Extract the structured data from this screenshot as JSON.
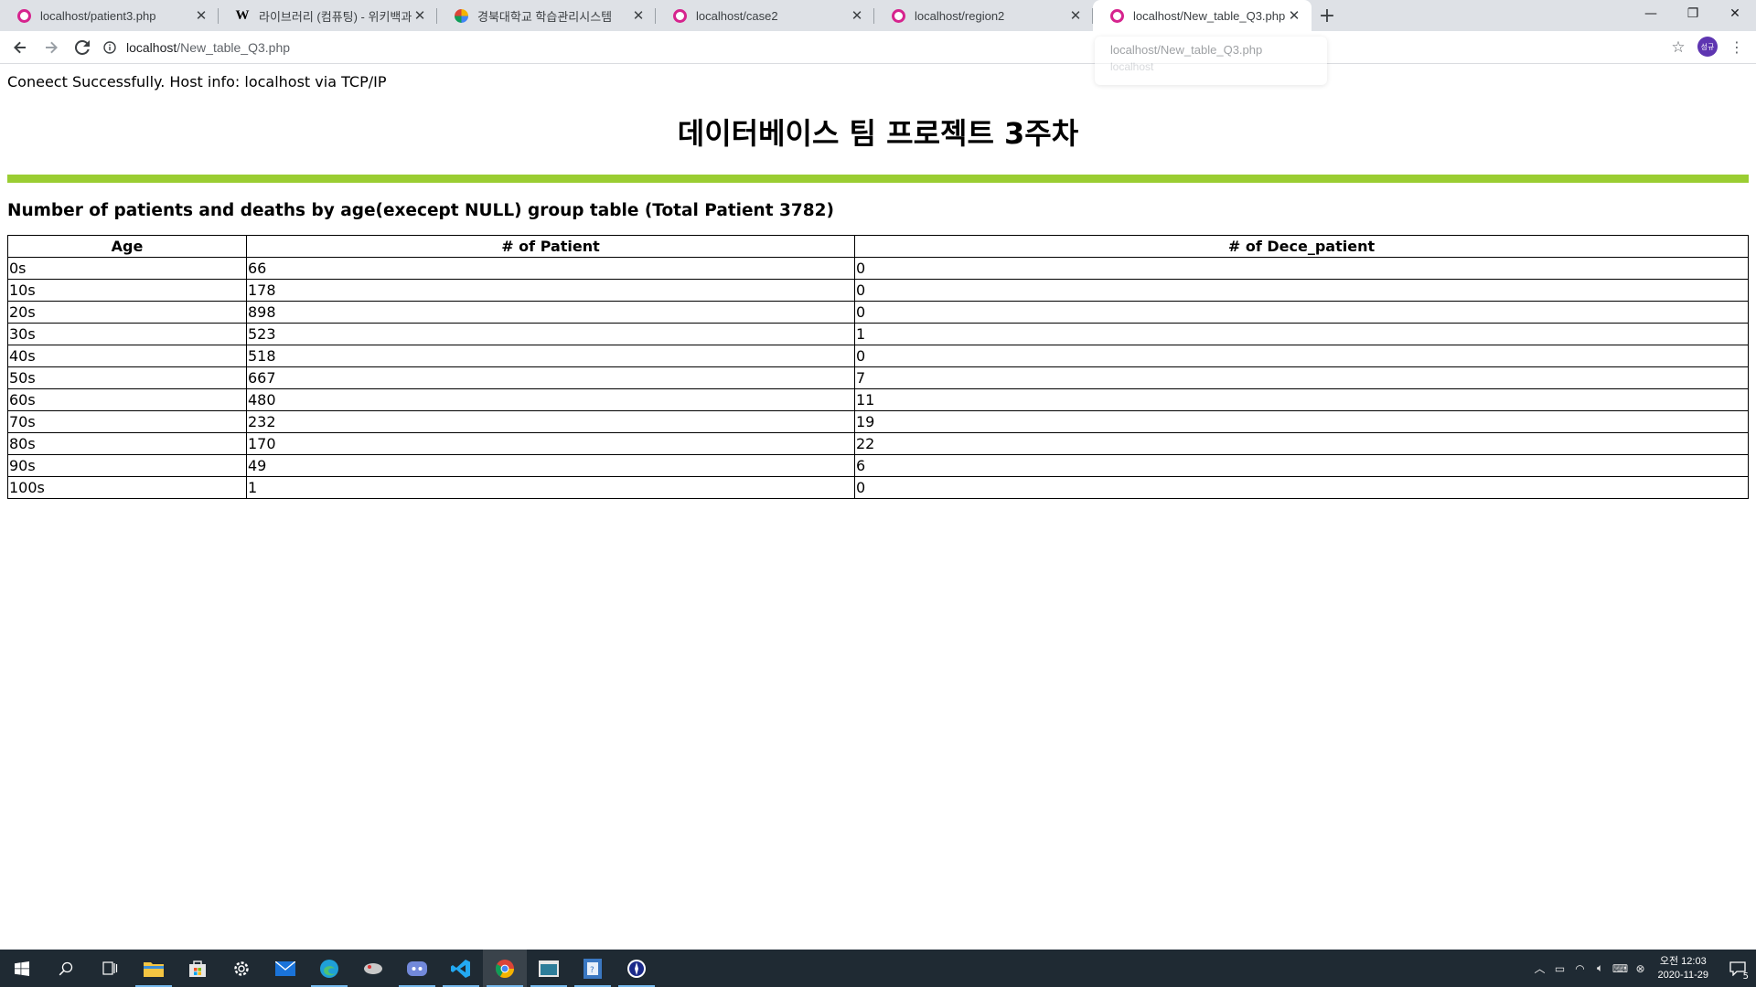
{
  "browser": {
    "tabs": [
      {
        "title": "localhost/patient3.php",
        "favicon": "localhost-icon"
      },
      {
        "title": "라이브러리 (컴퓨팅) - 위키백과",
        "favicon": "wikipedia-icon"
      },
      {
        "title": "경북대학교 학습관리시스템",
        "favicon": "knu-lms-icon"
      },
      {
        "title": "localhost/case2",
        "favicon": "localhost-icon"
      },
      {
        "title": "localhost/region2",
        "favicon": "localhost-icon"
      },
      {
        "title": "localhost/New_table_Q3.php",
        "favicon": "localhost-icon",
        "active": true
      }
    ],
    "url_host": "localhost",
    "url_path": "/New_table_Q3.php",
    "hover_card": {
      "title": "localhost/New_table_Q3.php",
      "domain": "localhost"
    },
    "profile_initials": "성규"
  },
  "page": {
    "status": "Coneect Successfully. Host info: localhost via TCP/IP",
    "title": "데이터베이스 팀 프로젝트 3주차",
    "rule_color": "#9acd32",
    "subtitle": "Number of patients and deaths by age(execept NULL) group table (Total Patient 3782)",
    "table": {
      "headers": [
        "Age",
        "# of Patient",
        "# of Dece_patient"
      ],
      "rows": [
        [
          "0s",
          "66",
          "0"
        ],
        [
          "10s",
          "178",
          "0"
        ],
        [
          "20s",
          "898",
          "0"
        ],
        [
          "30s",
          "523",
          "1"
        ],
        [
          "40s",
          "518",
          "0"
        ],
        [
          "50s",
          "667",
          "7"
        ],
        [
          "60s",
          "480",
          "11"
        ],
        [
          "70s",
          "232",
          "19"
        ],
        [
          "80s",
          "170",
          "22"
        ],
        [
          "90s",
          "49",
          "6"
        ],
        [
          "100s",
          "1",
          "0"
        ]
      ]
    }
  },
  "taskbar": {
    "clock_period": "오전 12:03",
    "clock_date": "2020-11-29",
    "notification_count": "5"
  }
}
